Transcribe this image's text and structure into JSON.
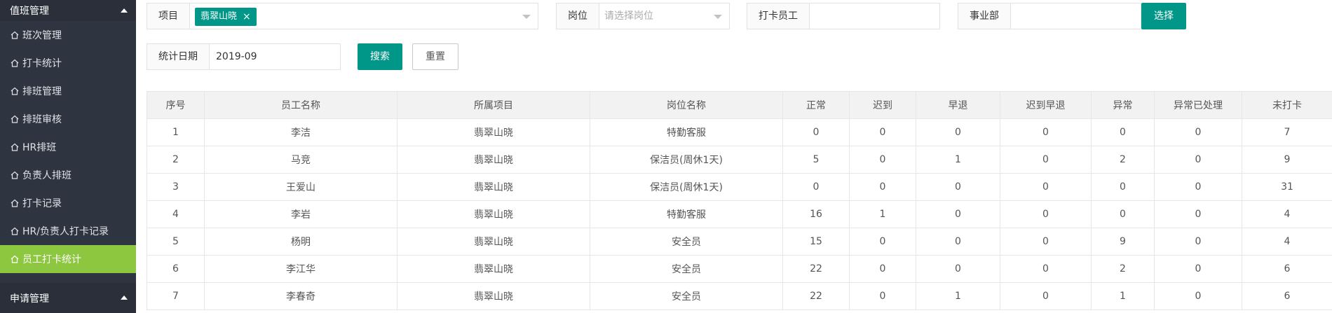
{
  "sidebar": {
    "group1": "值班管理",
    "items": [
      {
        "label": "班次管理",
        "active": false
      },
      {
        "label": "打卡统计",
        "active": false
      },
      {
        "label": "排班管理",
        "active": false
      },
      {
        "label": "排班审核",
        "active": false
      },
      {
        "label": "HR排班",
        "active": false
      },
      {
        "label": "负责人排班",
        "active": false
      },
      {
        "label": "打卡记录",
        "active": false
      },
      {
        "label": "HR/负责人打卡记录",
        "active": false
      },
      {
        "label": "员工打卡统计",
        "active": true
      }
    ],
    "group2": "申请管理"
  },
  "filters": {
    "project": {
      "label": "项目",
      "tag": "翡翠山晓",
      "tag_close": "×"
    },
    "position": {
      "label": "岗位",
      "placeholder": "请选择岗位"
    },
    "employee": {
      "label": "打卡员工",
      "value": ""
    },
    "division": {
      "label": "事业部",
      "value": ""
    },
    "select_button": "选择",
    "date": {
      "label": "统计日期",
      "value": "2019-09"
    },
    "search_button": "搜索",
    "reset_button": "重置"
  },
  "table": {
    "headers": [
      "序号",
      "员工名称",
      "所属项目",
      "岗位名称",
      "正常",
      "迟到",
      "早退",
      "迟到早退",
      "异常",
      "异常已处理",
      "未打卡"
    ],
    "rows": [
      [
        "1",
        "李洁",
        "翡翠山晓",
        "特勤客服",
        "0",
        "0",
        "0",
        "0",
        "0",
        "0",
        "7"
      ],
      [
        "2",
        "马竞",
        "翡翠山晓",
        "保洁员(周休1天)",
        "5",
        "0",
        "1",
        "0",
        "2",
        "0",
        "9"
      ],
      [
        "3",
        "王爱山",
        "翡翠山晓",
        "保洁员(周休1天)",
        "0",
        "0",
        "0",
        "0",
        "0",
        "0",
        "31"
      ],
      [
        "4",
        "李岩",
        "翡翠山晓",
        "特勤客服",
        "16",
        "1",
        "0",
        "0",
        "0",
        "0",
        "4"
      ],
      [
        "5",
        "杨明",
        "翡翠山晓",
        "安全员",
        "15",
        "0",
        "0",
        "0",
        "9",
        "0",
        "4"
      ],
      [
        "6",
        "李江华",
        "翡翠山晓",
        "安全员",
        "22",
        "0",
        "0",
        "0",
        "2",
        "0",
        "6"
      ],
      [
        "7",
        "李春奇",
        "翡翠山晓",
        "安全员",
        "22",
        "0",
        "1",
        "0",
        "1",
        "0",
        "6"
      ]
    ]
  },
  "colors": {
    "sidebar_bg": "#2f3540",
    "active_item": "#8dc63f",
    "primary": "#009688"
  }
}
